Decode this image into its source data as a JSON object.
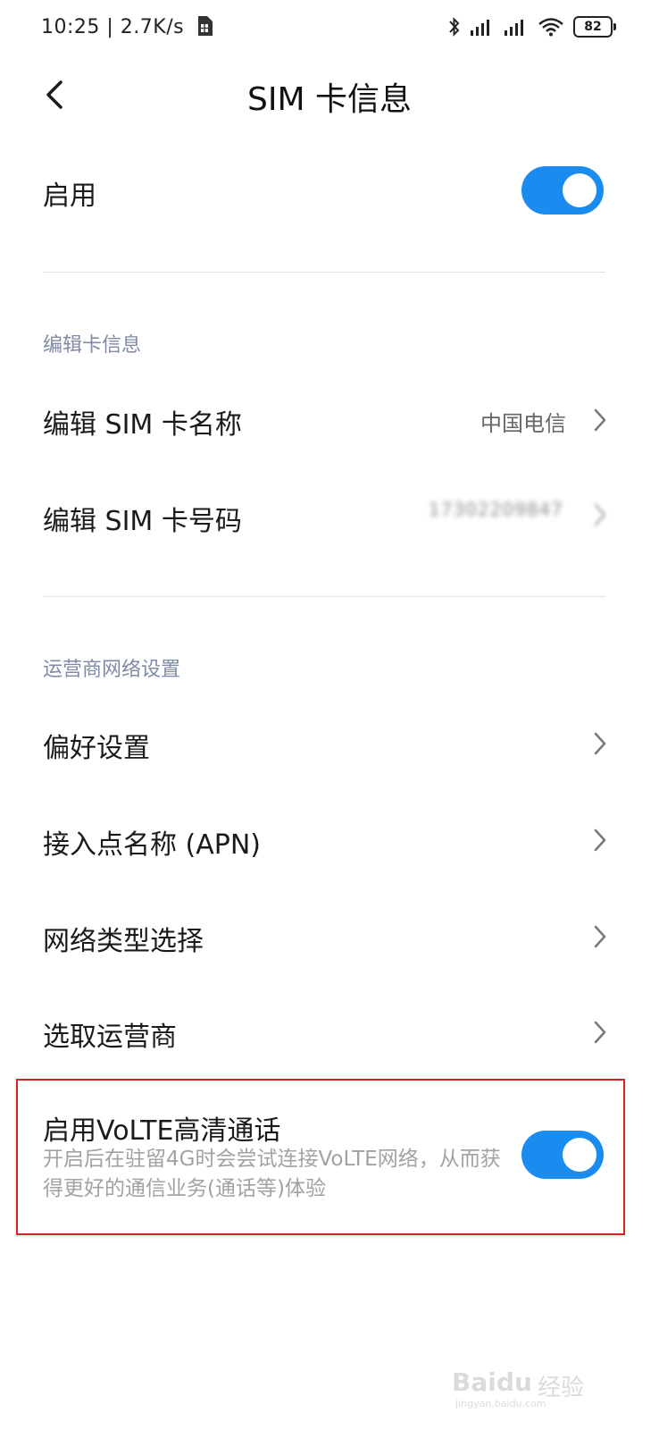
{
  "status_bar": {
    "time_speed": "10:25 | 2.7K/s",
    "battery": "82"
  },
  "header": {
    "title": "SIM 卡信息"
  },
  "enable": {
    "label": "启用",
    "on": true
  },
  "sections": {
    "edit_card": {
      "title": "编辑卡信息",
      "name_label": "编辑 SIM 卡名称",
      "name_value": "中国电信",
      "number_label": "编辑 SIM 卡号码",
      "number_value": "17302209847"
    },
    "carrier": {
      "title": "运营商网络设置",
      "preferences": "偏好设置",
      "apn": "接入点名称 (APN)",
      "network_type": "网络类型选择",
      "select_carrier": "选取运营商"
    }
  },
  "volte": {
    "title": "启用VoLTE高清通话",
    "description": "开启后在驻留4G时会尝试连接VoLTE网络，从而获得更好的通信业务(通话等)体验",
    "on": true
  },
  "watermark": {
    "brand": "Bai",
    "paw": "du",
    "suffix": "经验",
    "url": "jingyan.baidu.com"
  },
  "colors": {
    "accent": "#1a8cf0",
    "section_title": "#7e8aa6",
    "highlight_border": "#d32323"
  }
}
